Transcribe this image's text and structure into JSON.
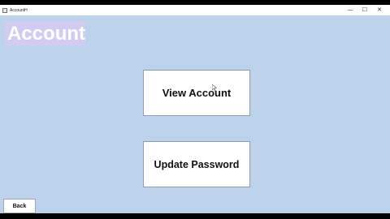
{
  "window": {
    "title": "AccountH",
    "controls": {
      "minimize": "—",
      "maximize": "☐",
      "close": "✕"
    }
  },
  "header": {
    "title": "Account"
  },
  "actions": {
    "view_account": "View Account",
    "update_password": "Update Password",
    "back": "Back"
  },
  "colors": {
    "background": "#bcd3eb",
    "header_box": "#d2cbf2",
    "button": "#ffffff"
  }
}
